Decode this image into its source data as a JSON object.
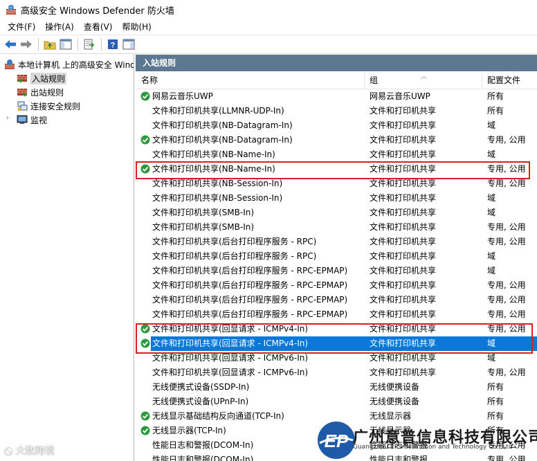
{
  "window": {
    "title": "高级安全 Windows Defender 防火墙"
  },
  "menu": [
    "文件(F)",
    "操作(A)",
    "查看(V)",
    "帮助(H)"
  ],
  "toolbar": [
    "back-arrow-icon",
    "forward-arrow-icon",
    "up-folder-icon",
    "show-hide-console-tree-icon",
    "export-list-icon",
    "help-icon",
    "properties-pane-icon"
  ],
  "tree": {
    "root": "本地计算机 上的高级安全 Windows Defender 防火墙",
    "items": [
      "入站规则",
      "出站规则",
      "连接安全规则",
      "监视"
    ],
    "selected": "入站规则"
  },
  "pane": {
    "title": "入站规则",
    "columns": [
      "名称",
      "组",
      "配置文件"
    ]
  },
  "rules": [
    {
      "name": "网易云音乐UWP",
      "group": "网易云音乐UWP",
      "profile": "所有",
      "enabled": true
    },
    {
      "name": "文件和打印机共享(LLMNR-UDP-In)",
      "group": "文件和打印机共享",
      "profile": "所有",
      "enabled": false
    },
    {
      "name": "文件和打印机共享(NB-Datagram-In)",
      "group": "文件和打印机共享",
      "profile": "域",
      "enabled": false
    },
    {
      "name": "文件和打印机共享(NB-Datagram-In)",
      "group": "文件和打印机共享",
      "profile": "专用, 公用",
      "enabled": true
    },
    {
      "name": "文件和打印机共享(NB-Name-In)",
      "group": "文件和打印机共享",
      "profile": "域",
      "enabled": false
    },
    {
      "name": "文件和打印机共享(NB-Name-In)",
      "group": "文件和打印机共享",
      "profile": "专用, 公用",
      "enabled": true
    },
    {
      "name": "文件和打印机共享(NB-Session-In)",
      "group": "文件和打印机共享",
      "profile": "专用, 公用",
      "enabled": false
    },
    {
      "name": "文件和打印机共享(NB-Session-In)",
      "group": "文件和打印机共享",
      "profile": "域",
      "enabled": false
    },
    {
      "name": "文件和打印机共享(SMB-In)",
      "group": "文件和打印机共享",
      "profile": "域",
      "enabled": false
    },
    {
      "name": "文件和打印机共享(SMB-In)",
      "group": "文件和打印机共享",
      "profile": "专用, 公用",
      "enabled": false
    },
    {
      "name": "文件和打印机共享(后台打印程序服务 - RPC)",
      "group": "文件和打印机共享",
      "profile": "专用, 公用",
      "enabled": false
    },
    {
      "name": "文件和打印机共享(后台打印程序服务 - RPC)",
      "group": "文件和打印机共享",
      "profile": "域",
      "enabled": false
    },
    {
      "name": "文件和打印机共享(后台打印程序服务 - RPC-EPMAP)",
      "group": "文件和打印机共享",
      "profile": "域",
      "enabled": false
    },
    {
      "name": "文件和打印机共享(后台打印程序服务 - RPC-EPMAP)",
      "group": "文件和打印机共享",
      "profile": "专用, 公用",
      "enabled": false
    },
    {
      "name": "文件和打印机共享(后台打印程序服务 - RPC-EPMAP)",
      "group": "文件和打印机共享",
      "profile": "专用, 公用",
      "enabled": false
    },
    {
      "name": "文件和打印机共享(后台打印程序服务 - RPC-EPMAP)",
      "group": "文件和打印机共享",
      "profile": "专用, 公用",
      "enabled": false
    },
    {
      "name": "文件和打印机共享(回显请求 - ICMPv4-In)",
      "group": "文件和打印机共享",
      "profile": "专用, 公用",
      "enabled": true
    },
    {
      "name": "文件和打印机共享(回显请求 - ICMPv4-In)",
      "group": "文件和打印机共享",
      "profile": "域",
      "enabled": true,
      "selected": true
    },
    {
      "name": "文件和打印机共享(回显请求 - ICMPv6-In)",
      "group": "文件和打印机共享",
      "profile": "域",
      "enabled": false
    },
    {
      "name": "文件和打印机共享(回显请求 - ICMPv6-In)",
      "group": "文件和打印机共享",
      "profile": "专用, 公用",
      "enabled": false
    },
    {
      "name": "无线便携式设备(SSDP-In)",
      "group": "无线便携设备",
      "profile": "所有",
      "enabled": false
    },
    {
      "name": "无线便携式设备(UPnP-In)",
      "group": "无线便携设备",
      "profile": "所有",
      "enabled": false
    },
    {
      "name": "无线显示基础结构反向通道(TCP-In)",
      "group": "无线显示器",
      "profile": "所有",
      "enabled": true
    },
    {
      "name": "无线显示器(TCP-In)",
      "group": "无线显示器",
      "profile": "所有",
      "enabled": true
    },
    {
      "name": "性能日志和警报(DCOM-In)",
      "group": "性能日志和警报",
      "profile": "专用, 公用",
      "enabled": false
    },
    {
      "name": "性能日志和警报(DCOM-In)",
      "group": "性能日志和警报",
      "profile": "专用, 公用",
      "enabled": false
    }
  ],
  "highlighted_rows": [
    5,
    16,
    17
  ],
  "watermark": {
    "company": "广州意普信息科技有限公司",
    "english": "Guangzhou EP Information and Technology Co., Ltd",
    "logo_text": "EP",
    "stamp": "大数跨境"
  },
  "colors": {
    "accent": "#0b78d7",
    "header": "#5b7890",
    "highlight_box": "#d8211f",
    "enabled_check": "#2e9a3e"
  }
}
